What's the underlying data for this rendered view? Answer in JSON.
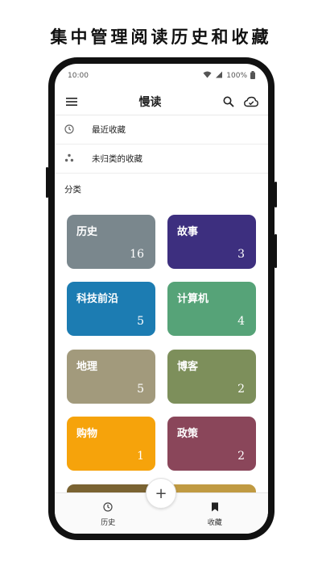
{
  "headline": "集中管理阅读历史和收藏",
  "status": {
    "time": "10:00",
    "battery": "100%"
  },
  "appbar": {
    "title": "慢读",
    "menu_icon": "menu-icon",
    "search_icon": "search-icon",
    "cloud_icon": "cloud-sync-icon"
  },
  "list": [
    {
      "label": "最近收藏",
      "icon": "history-icon"
    },
    {
      "label": "未归类的收藏",
      "icon": "dots-icon"
    }
  ],
  "section_label": "分类",
  "categories": [
    {
      "name": "历史",
      "count": "16",
      "color": "#7a878d"
    },
    {
      "name": "故事",
      "count": "3",
      "color": "#3d2f7f"
    },
    {
      "name": "科技前沿",
      "count": "5",
      "color": "#1c7cb2"
    },
    {
      "name": "计算机",
      "count": "4",
      "color": "#56a378"
    },
    {
      "name": "地理",
      "count": "5",
      "color": "#a29a7c"
    },
    {
      "name": "博客",
      "count": "2",
      "color": "#7d8f5b"
    },
    {
      "name": "购物",
      "count": "1",
      "color": "#f6a30b"
    },
    {
      "name": "政策",
      "count": "2",
      "color": "#8a465a"
    }
  ],
  "partial_colors": [
    "#7a6332",
    "#c09a42"
  ],
  "bottom_nav": [
    {
      "label": "历史",
      "icon": "history-icon"
    },
    {
      "label": "收藏",
      "icon": "bookmark-icon"
    }
  ],
  "fab": {
    "label": "+"
  }
}
